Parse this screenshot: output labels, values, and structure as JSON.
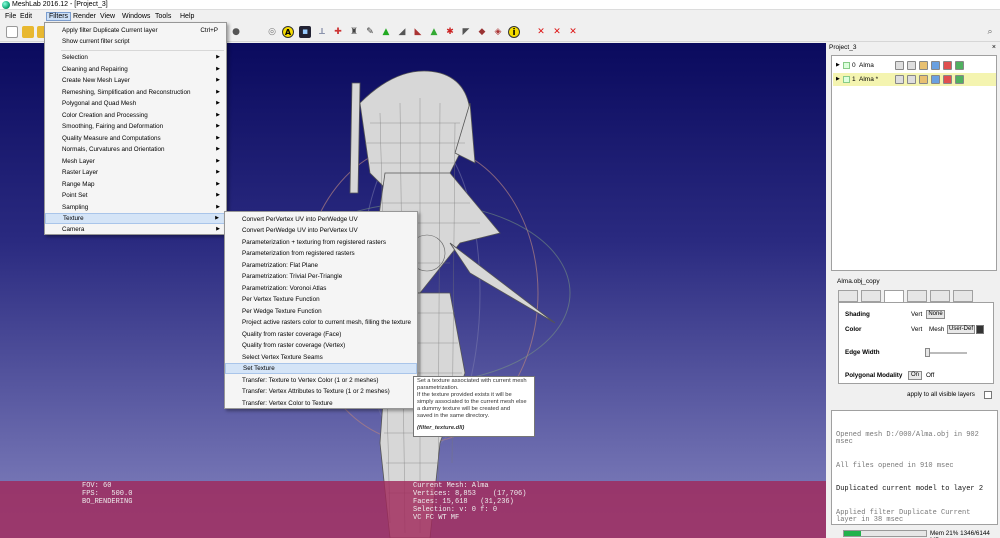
{
  "window": {
    "title": "MeshLab 2016.12 - [Project_3]"
  },
  "menubar": [
    "File",
    "Edit",
    "Filters",
    "Render",
    "View",
    "Windows",
    "Tools",
    "Help"
  ],
  "filters_menu": {
    "items": [
      {
        "label": "Apply filter Duplicate Current layer",
        "shortcut": "Ctrl+P"
      },
      {
        "label": "Show current filter script"
      },
      {
        "label": "Selection"
      },
      {
        "label": "Cleaning and Repairing"
      },
      {
        "label": "Create New Mesh Layer"
      },
      {
        "label": "Remeshing, Simplification and Reconstruction"
      },
      {
        "label": "Polygonal and Quad Mesh"
      },
      {
        "label": "Color Creation and Processing"
      },
      {
        "label": "Smoothing, Fairing and Deformation"
      },
      {
        "label": "Quality Measure and Computations"
      },
      {
        "label": "Normals, Curvatures and Orientation"
      },
      {
        "label": "Mesh Layer"
      },
      {
        "label": "Raster Layer"
      },
      {
        "label": "Range Map"
      },
      {
        "label": "Point Set"
      },
      {
        "label": "Sampling"
      },
      {
        "label": "Texture"
      },
      {
        "label": "Camera"
      }
    ]
  },
  "texture_menu": {
    "items": [
      "Convert PerVertex UV into PerWedge UV",
      "Convert PerWedge UV into PerVertex UV",
      "Parameterization + texturing from registered rasters",
      "Parameterization from registered rasters",
      "Parametrization: Flat Plane",
      "Parametrization: Trivial Per-Triangle",
      "Parametrization: Voronoi Atlas",
      "Per Vertex Texture Function",
      "Per Wedge Texture Function",
      "Project active rasters color to current mesh, filling the texture",
      "Quality from raster coverage (Face)",
      "Quality from raster coverage (Vertex)",
      "Select Vertex Texture Seams",
      "Set Texture",
      "Transfer: Texture to Vertex Color (1 or 2 meshes)",
      "Transfer: Vertex Attributes to Texture (1 or 2 meshes)",
      "Transfer: Vertex Color to Texture"
    ]
  },
  "tooltip": {
    "lines": [
      "Set a texture associated with current mesh",
      "parametrization.",
      "If the texture provided exists it will be",
      "simply associated to the current mesh else",
      "a dummy texture will be created and",
      "saved in the same directory."
    ],
    "code": "(filter_texture.dll)"
  },
  "viewport": {
    "info_left": "FOV: 60\nFPS:   500.0\nBO_RENDERING",
    "info_right": "Current Mesh: Alma\nVertices: 8,853    (17,706)\nFaces: 15,618   (31,236)\nSelection: v: 0 f: 0\nVC FC WT MF"
  },
  "layer_panel": {
    "title": "Project_3",
    "close": "×",
    "layers": [
      {
        "index": "0",
        "name": "Alma",
        "selected": false
      },
      {
        "index": "1",
        "name": "Alma *",
        "selected": true
      }
    ]
  },
  "plugin": {
    "title": "Alma.obj_copy",
    "shading_label": "Shading",
    "shading_vert": "Vert",
    "shading_value": "None",
    "color_label": "Color",
    "color_vert": "Vert",
    "color_mesh": "Mesh",
    "color_value": "User-Def",
    "edge_width_label": "Edge Width",
    "poly_label": "Polygonal Modality",
    "poly_on": "On",
    "poly_off": "Off",
    "apply_all": "apply to all visible layers"
  },
  "log": {
    "lines": [
      {
        "text": "Opened mesh D:/000/Alma.obj in 902 msec",
        "dark": false
      },
      {
        "text": "All files opened in 910 msec",
        "dark": false
      },
      {
        "text": "Duplicated current model to layer 2",
        "dark": true
      },
      {
        "text": "Applied filter Duplicate Current layer in 38 msec",
        "dark": false
      }
    ]
  },
  "status": {
    "progress": 0.21,
    "mem_text": "Mem 21% 1346/6144 MB"
  },
  "colors": {
    "accent_menu": "#cde0f7",
    "overlay": "#a0285a",
    "selected_layer": "#f4f4b0"
  }
}
